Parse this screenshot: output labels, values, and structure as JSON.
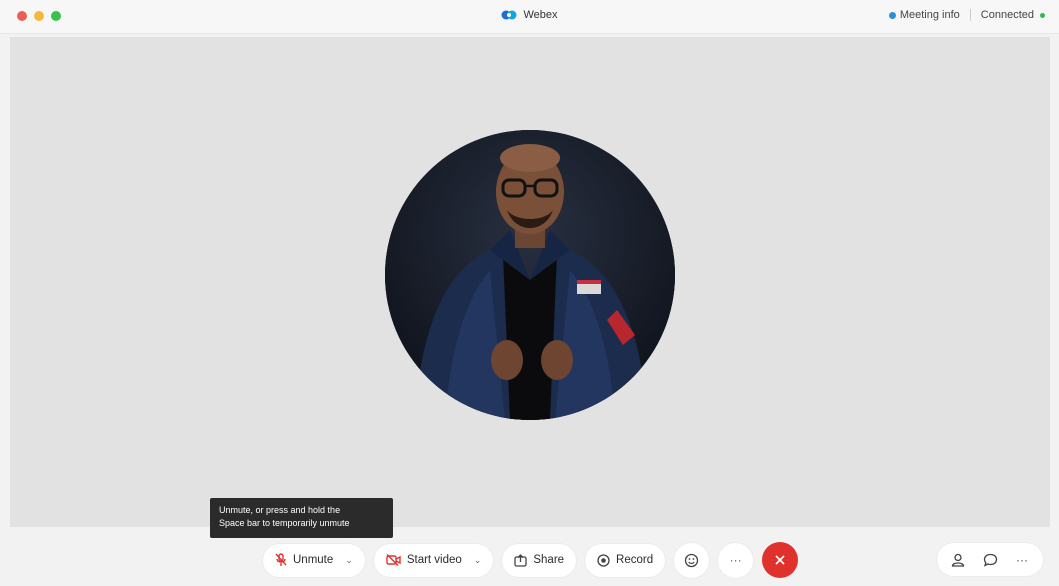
{
  "window": {
    "app_title": "Webex",
    "meeting_info_label": "Meeting info",
    "connection_status": "Connected"
  },
  "colors": {
    "stage_bg": "#e2e2e2",
    "end_call_red": "#e0322c",
    "mute_red": "#e0322c",
    "connected_green": "#2dbb4c",
    "info_blue": "#2f8ed8"
  },
  "tooltip": {
    "line1": "Unmute, or press and hold the",
    "line2": "Space bar to temporarily unmute"
  },
  "controls": {
    "unmute_label": "Unmute",
    "start_video_label": "Start video",
    "share_label": "Share",
    "record_label": "Record",
    "more_glyph": "···",
    "icons": [
      "microphone-muted-icon",
      "video-off-icon",
      "share-icon",
      "record-icon",
      "reactions-icon",
      "more-icon",
      "end-call-icon"
    ]
  },
  "right_controls": {
    "more_glyph": "···",
    "icons": [
      "participants-icon",
      "chat-icon",
      "more-options-icon"
    ]
  },
  "stage": {
    "avatar": "participant-photo"
  }
}
